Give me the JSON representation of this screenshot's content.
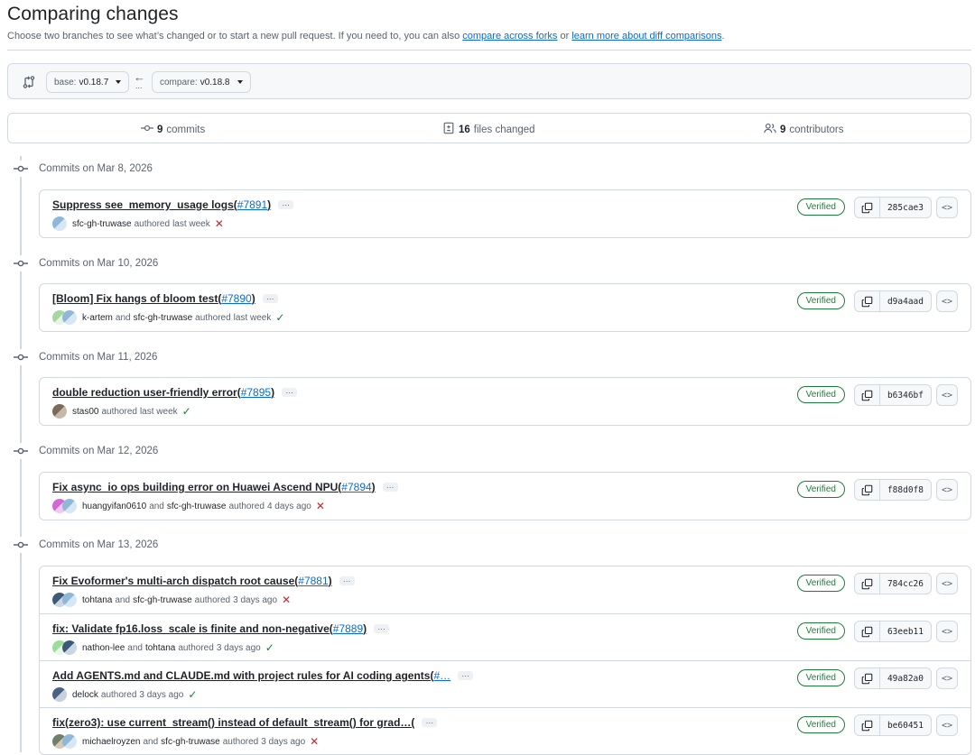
{
  "header": {
    "title": "Comparing changes",
    "subtitle_prefix": "Choose two branches to see what’s changed or to start a new pull request. If you need to, you can also ",
    "link_forks": "compare across forks",
    "subtitle_or": " or ",
    "link_learn": "learn more about diff comparisons",
    "subtitle_end": "."
  },
  "range": {
    "base_label": "base:",
    "base_value": "v0.18.7",
    "compare_label": "compare:",
    "compare_value": "v0.18.8",
    "arrow": "←",
    "dots": "..."
  },
  "stats": {
    "commits_count": "9",
    "commits_label": "commits",
    "files_count": "16",
    "files_label": "files changed",
    "contributors_count": "9",
    "contributors_label": "contributors"
  },
  "common": {
    "verified": "Verified",
    "and": "and",
    "authored": "authored",
    "ellipsis": "…",
    "browse": "<>"
  },
  "groups": [
    {
      "date": "Commits on Mar 8, 2026",
      "commits": [
        {
          "message": "Suppress see_memory_usage logs",
          "pr_open": "(",
          "pr": "#7891",
          "pr_close": ")",
          "authors": [
            "sfc-gh-truwase"
          ],
          "time": "last week",
          "status": "fail",
          "sha": "285cae3"
        }
      ]
    },
    {
      "date": "Commits on Mar 10, 2026",
      "commits": [
        {
          "message": "[Bloom] Fix hangs of bloom test",
          "pr_open": "(",
          "pr": "#7890",
          "pr_close": ")",
          "authors": [
            "k-artem",
            "sfc-gh-truwase"
          ],
          "time": "last week",
          "status": "success",
          "sha": "d9a4aad"
        }
      ]
    },
    {
      "date": "Commits on Mar 11, 2026",
      "commits": [
        {
          "message": "double reduction user-friendly error",
          "pr_open": "(",
          "pr": "#7895",
          "pr_close": ")",
          "authors": [
            "stas00"
          ],
          "time": "last week",
          "status": "success",
          "sha": "b6346bf"
        }
      ]
    },
    {
      "date": "Commits on Mar 12, 2026",
      "commits": [
        {
          "message": "Fix async_io ops building error on Huawei Ascend NPU",
          "pr_open": "(",
          "pr": "#7894",
          "pr_close": ")",
          "authors": [
            "huangyifan0610",
            "sfc-gh-truwase"
          ],
          "time": "4 days ago",
          "status": "fail",
          "sha": "f88d0f8"
        }
      ]
    },
    {
      "date": "Commits on Mar 13, 2026",
      "commits": [
        {
          "message": "Fix Evoformer's multi-arch dispatch root cause",
          "pr_open": "(",
          "pr": "#7881",
          "pr_close": ")",
          "authors": [
            "tohtana",
            "sfc-gh-truwase"
          ],
          "time": "3 days ago",
          "status": "fail",
          "sha": "784cc26"
        },
        {
          "message": "fix: Validate fp16.loss_scale is finite and non-negative",
          "pr_open": "(",
          "pr": "#7889",
          "pr_close": ")",
          "authors": [
            "nathon-lee",
            "tohtana"
          ],
          "time": "3 days ago",
          "status": "success",
          "sha": "63eeb11"
        },
        {
          "message": "Add AGENTS.md and CLAUDE.md with project rules for AI coding agents",
          "pr_open": "(",
          "pr": "#…",
          "pr_close": "",
          "authors": [
            "delock"
          ],
          "time": "3 days ago",
          "status": "success",
          "sha": "49a82a0"
        },
        {
          "message": "fix(zero3): use current_stream() instead of default_stream() for grad…",
          "pr_open": " (",
          "pr": "",
          "pr_close": "",
          "authors": [
            "michaelroyzen",
            "sfc-gh-truwase"
          ],
          "time": "3 days ago",
          "status": "fail",
          "sha": "be60451"
        }
      ]
    }
  ],
  "icons": {
    "compare": "git-compare-icon",
    "commit": "git-commit-icon",
    "file_diff": "file-diff-icon",
    "people": "people-icon",
    "copy": "copy-icon",
    "check": "check-icon",
    "x": "x-icon"
  },
  "colors": {
    "link": "#0969da",
    "success": "#1a7f37",
    "danger": "#cf222e",
    "muted": "#59636e",
    "border": "#d1d9e0"
  }
}
